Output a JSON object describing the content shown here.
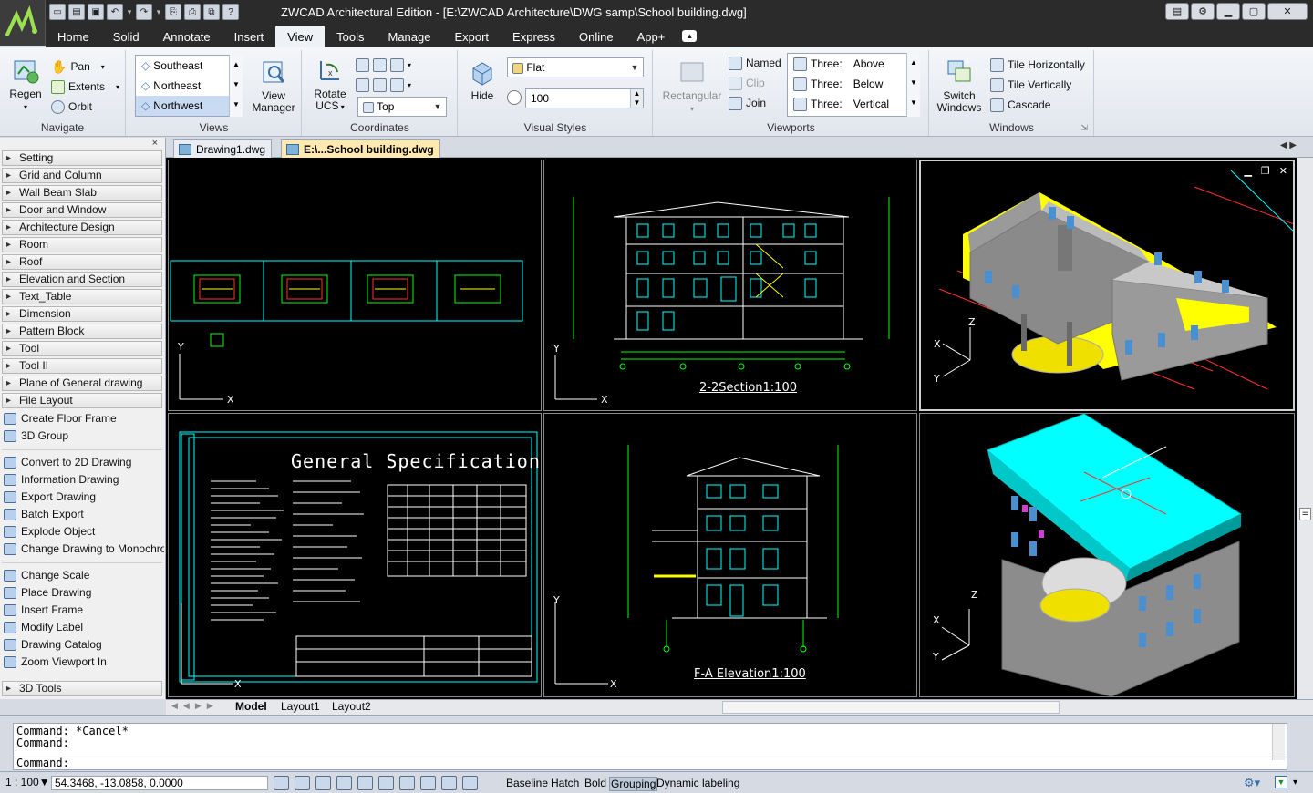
{
  "app": {
    "title": "ZWCAD Architectural Edition - [E:\\ZWCAD Architecture\\DWG samp\\School building.dwg]",
    "colors": {
      "titlebar": "#2b2b2b",
      "ribbon": "#eef1f5",
      "accent_cyan": "#00ffff",
      "accent_yellow": "#ffff00",
      "line_green": "#00ff00",
      "doc_active_tab": "#ffe9b0"
    }
  },
  "ribbon_tabs": [
    {
      "label": "Home"
    },
    {
      "label": "Solid"
    },
    {
      "label": "Annotate"
    },
    {
      "label": "Insert"
    },
    {
      "label": "View",
      "active": true
    },
    {
      "label": "Tools"
    },
    {
      "label": "Manage"
    },
    {
      "label": "Export"
    },
    {
      "label": "Express"
    },
    {
      "label": "Online"
    },
    {
      "label": "App+"
    }
  ],
  "ribbon": {
    "navigate": {
      "label": "Navigate",
      "regen": "Regen",
      "pan": "Pan",
      "extents": "Extents",
      "orbit": "Orbit"
    },
    "views": {
      "label": "Views",
      "items": [
        "Southeast",
        "Northeast",
        "Northwest"
      ],
      "selected": "Northwest",
      "manager": "View Manager"
    },
    "coordinates": {
      "label": "Coordinates",
      "rotate_ucs": "Rotate UCS",
      "combo_value": "Top"
    },
    "visual_styles": {
      "label": "Visual Styles",
      "hide": "Hide",
      "style_value": "Flat",
      "opacity_value": "100"
    },
    "viewports": {
      "label": "Viewports",
      "rectangular": "Rectangular",
      "named": "Named",
      "clip": "Clip",
      "join": "Join",
      "configs": [
        {
          "prefix": "Three:",
          "value": "Above"
        },
        {
          "prefix": "Three:",
          "value": "Below"
        },
        {
          "prefix": "Three:",
          "value": "Vertical"
        }
      ]
    },
    "windows": {
      "label": "Windows",
      "switch": "Switch Windows",
      "tile_h": "Tile Horizontally",
      "tile_v": "Tile Vertically",
      "cascade": "Cascade"
    }
  },
  "palette": {
    "categories_top": [
      "Setting",
      "Grid and Column",
      "Wall Beam Slab",
      "Door and Window",
      "Architecture Design",
      "Room",
      "Roof",
      "Elevation and Section",
      "Text_Table",
      "Dimension",
      "Pattern Block",
      "Tool",
      "Tool II",
      "Plane of General drawing",
      "File Layout"
    ],
    "group1": [
      "Create Floor Frame",
      "3D Group"
    ],
    "group2": [
      "Convert to 2D Drawing",
      "Information Drawing",
      "Export Drawing",
      "Batch Export",
      "Explode Object",
      "Change Drawing to Monochrome"
    ],
    "group3": [
      "Change Scale",
      "Place Drawing",
      "Insert Frame",
      "Modify Label",
      "Drawing Catalog",
      "Zoom Viewport In"
    ],
    "category_bottom": "3D Tools"
  },
  "doc_tabs": [
    {
      "label": "Drawing1.dwg",
      "active": false
    },
    {
      "label": "E:\\...School building.dwg",
      "active": true
    }
  ],
  "viewports": {
    "section_label": "2-2Section1:100",
    "spec_title": "General Specification",
    "elevation_label": "F-A Elevation1:100",
    "axis_x": "X",
    "axis_y": "Y",
    "axis_z": "Z"
  },
  "layout_tabs": [
    "Model",
    "Layout1",
    "Layout2"
  ],
  "command": {
    "history": [
      "Command: *Cancel*",
      "Command:"
    ],
    "prompt": "Command:"
  },
  "status": {
    "scale": "1 : 100",
    "coords": "54.3468, -13.0858, 0.0000",
    "toggles": [
      {
        "label": "Baseline",
        "on": false
      },
      {
        "label": "Hatch",
        "on": false
      },
      {
        "label": "Bold",
        "on": false
      },
      {
        "label": "Grouping",
        "on": true
      },
      {
        "label": "Dynamic labeling",
        "on": false
      }
    ]
  }
}
